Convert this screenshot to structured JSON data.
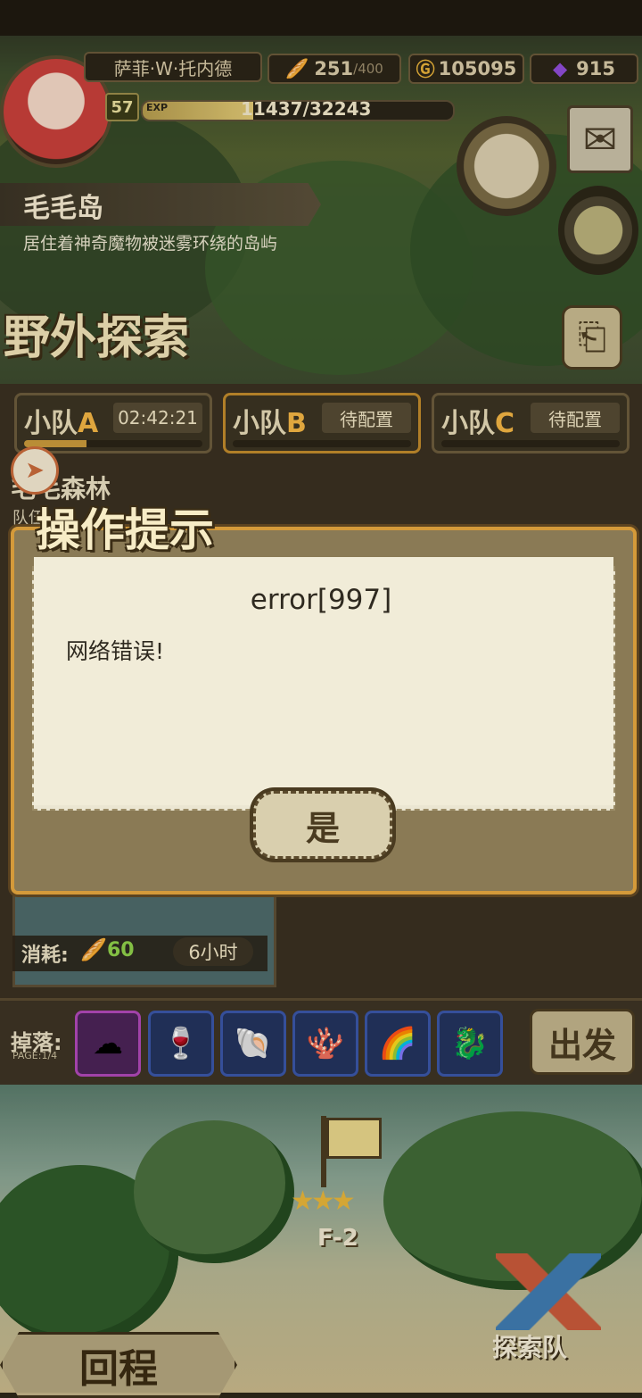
{
  "header": {
    "player_name": "萨菲·W·托内德",
    "stamina": "251",
    "stamina_max": "/400",
    "gold": "105095",
    "gems": "915",
    "level": "57",
    "exp_tag": "EXP",
    "exp_value": "11437/32243",
    "exp_progress": 0.355
  },
  "location": {
    "island_name": "毛毛岛",
    "island_desc": "居住着神奇魔物被迷雾环绕的岛屿",
    "mode_title": "野外探索",
    "area_name": "毛毛森林",
    "team_prefix": "队伍"
  },
  "squads": [
    {
      "prefix": "小队",
      "letter": "A",
      "status": "02:42:21",
      "progress": 0.35
    },
    {
      "prefix": "小队",
      "letter": "B",
      "status": "待配置",
      "progress": 0
    },
    {
      "prefix": "小队",
      "letter": "C",
      "status": "待配置",
      "progress": 0
    }
  ],
  "expedition": {
    "consume_label": "消耗:",
    "consume_value": "60",
    "duration": "6小时"
  },
  "drops": {
    "label": "掉落:",
    "page": "PAGE:1/4",
    "items": [
      "wool-icon",
      "wine-glass-icon",
      "shells-icon",
      "coral-icon",
      "rainbow-cloth-icon",
      "dragon-figure-icon"
    ]
  },
  "buttons": {
    "depart": "出发",
    "return": "回程",
    "team": "探索队"
  },
  "stage": {
    "label": "F-2",
    "stars": "★★★"
  },
  "dialog": {
    "title": "操作提示",
    "code": "error[997]",
    "message": "网络错误!",
    "confirm": "是"
  },
  "colors": {
    "dialog_border": "#d49a3a",
    "accent_orange": "#f2b544",
    "consume_green": "#8fd04a"
  }
}
